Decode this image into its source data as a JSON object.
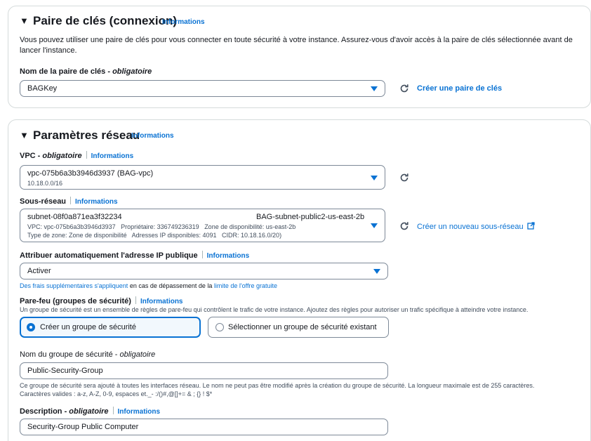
{
  "keypair": {
    "title": "Paire de clés (connexion)",
    "info": "Informations",
    "description_line1": "Vous pouvez utiliser une paire de clés pour vous connecter en toute sécurité à votre instance. Assurez-vous d'avoir accès à la paire de clés sélectionnée avant de",
    "description_line2": "lancer l'instance.",
    "field_label": "Nom de la paire de clés",
    "field_required": "obligatoire",
    "selected": "BAGKey",
    "create_link": "Créer une paire de clés"
  },
  "network": {
    "title": "Paramètres réseau",
    "info": "Informations",
    "vpc": {
      "label": "VPC",
      "required": "obligatoire",
      "info": "Informations",
      "value": "vpc-075b6a3b3946d3937 (BAG-vpc)",
      "cidr": "10.18.0.0/16"
    },
    "subnet": {
      "label": "Sous-réseau",
      "info": "Informations",
      "id": "subnet-08f0a871ea3f32234",
      "name": "BAG-subnet-public2-us-east-2b",
      "line2": "VPC: vpc-075b6a3b3946d3937   Propriétaire: 336749236319   Zone de disponibilité: us-east-2b",
      "line3": "Type de zone: Zone de disponibilité   Adresses IP disponibles: 4091   CIDR: 10.18.16.0/20)",
      "create_link": "Créer un nouveau sous-réseau"
    },
    "public_ip": {
      "label": "Attribuer automatiquement l'adresse IP publique",
      "info": "Informations",
      "value": "Activer",
      "note_link1": "Des frais supplémentaires s'appliquent",
      "note_text": " en cas de dépassement de la ",
      "note_link2": "limite de l'offre gratuite"
    },
    "firewall": {
      "label": "Pare-feu (groupes de sécurité)",
      "info": "Informations",
      "description": "Un groupe de sécurité est un ensemble de règles de pare-feu qui contrôlent le trafic de votre instance. Ajoutez des règles pour autoriser un trafic spécifique à atteindre votre instance.",
      "option_create": "Créer un groupe de sécurité",
      "option_select": "Sélectionner un groupe de sécurité existant"
    },
    "sg_name": {
      "label": "Nom du groupe de sécurité",
      "required": "obligatoire",
      "value": "Public-Security-Group",
      "help_line1": "Ce groupe de sécurité sera ajouté à toutes les interfaces réseau. Le nom ne peut pas être modifié après la création du groupe de sécurité. La longueur maximale est de 255 caractères.",
      "help_line2": "Caractères valides : a-z, A-Z, 0-9, espaces et._- :/()#,@[]+= & ; {} ! $*"
    },
    "description": {
      "label": "Description",
      "required": "obligatoire",
      "info": "Informations",
      "value": "Security-Group Public Computer"
    }
  },
  "colors": {
    "link": "#0972d3",
    "border": "#7d8998",
    "selected_card_bg": "#f2f8fd"
  }
}
